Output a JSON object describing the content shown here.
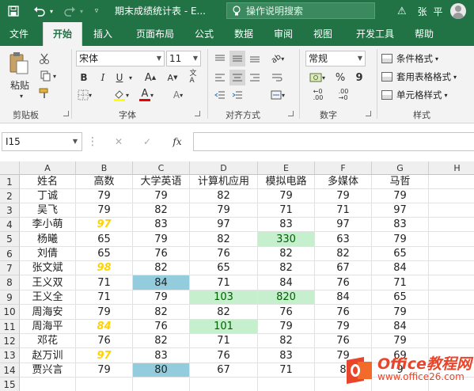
{
  "titlebar": {
    "title": "期末成绩统计表 - E...",
    "search_placeholder": "操作说明搜索",
    "user_name": "张 平",
    "icons": [
      "save-icon",
      "undo-icon",
      "redo-icon",
      "customize-icon",
      "lightbulb-icon",
      "warning-icon",
      "avatar"
    ]
  },
  "tabs": [
    "文件",
    "开始",
    "插入",
    "页面布局",
    "公式",
    "数据",
    "审阅",
    "视图",
    "开发工具",
    "帮助"
  ],
  "active_tab": "开始",
  "ribbon": {
    "clipboard": {
      "label": "剪贴板",
      "paste": "粘贴"
    },
    "font": {
      "label": "字体",
      "name": "宋体",
      "size": "11",
      "bold": "B",
      "italic": "I",
      "underline": "U",
      "font_color_letter": "A",
      "ab_glyph": "A"
    },
    "alignment": {
      "label": "对齐方式"
    },
    "number": {
      "label": "数字",
      "format": "常规",
      "percent": "%",
      "comma": "9"
    },
    "styles": {
      "label": "样式",
      "conditional": "条件格式",
      "table": "套用表格格式",
      "cell": "单元格样式"
    }
  },
  "formula_bar": {
    "name_box": "I15",
    "fx": "fx",
    "cancel": "✕",
    "enter": "✓",
    "value": ""
  },
  "sheet": {
    "columns": [
      "A",
      "B",
      "C",
      "D",
      "E",
      "F",
      "G",
      "H"
    ],
    "rows": [
      [
        "姓名",
        "高数",
        "大学英语",
        "计算机应用",
        "模拟电路",
        "多媒体",
        "马哲",
        ""
      ],
      [
        "丁诚",
        "79",
        "79",
        "82",
        "79",
        "79",
        "79",
        ""
      ],
      [
        "吴飞",
        "79",
        "82",
        "79",
        "71",
        "71",
        "97",
        ""
      ],
      [
        "李小萌",
        "97",
        "83",
        "97",
        "83",
        "97",
        "83",
        ""
      ],
      [
        "杨曦",
        "65",
        "79",
        "82",
        "330",
        "63",
        "79",
        ""
      ],
      [
        "刘倩",
        "65",
        "76",
        "76",
        "82",
        "82",
        "65",
        ""
      ],
      [
        "张文斌",
        "98",
        "82",
        "65",
        "82",
        "67",
        "84",
        ""
      ],
      [
        "王义双",
        "71",
        "84",
        "71",
        "84",
        "76",
        "71",
        ""
      ],
      [
        "王义全",
        "71",
        "79",
        "103",
        "820",
        "84",
        "65",
        ""
      ],
      [
        "周海安",
        "79",
        "82",
        "82",
        "76",
        "76",
        "79",
        ""
      ],
      [
        "周海平",
        "84",
        "76",
        "101",
        "79",
        "79",
        "84",
        ""
      ],
      [
        "邓花",
        "76",
        "82",
        "71",
        "82",
        "76",
        "79",
        ""
      ],
      [
        "赵万训",
        "97",
        "83",
        "76",
        "83",
        "79",
        "69",
        ""
      ],
      [
        "贾兴言",
        "79",
        "80",
        "67",
        "71",
        "8",
        "9",
        ""
      ],
      [
        "",
        "",
        "",
        "",
        "",
        "",
        "",
        ""
      ]
    ],
    "highlight_colors": {
      "yellow_text": "#ffd200",
      "blue_fill": "#93cddd",
      "green_fill": "#c6efce",
      "green_text": "#006100"
    }
  },
  "watermark": {
    "line1": "Office教程网",
    "line2": "www.office26.com"
  },
  "colors": {
    "brand": "#217346",
    "ribbon_bg": "#f3f3f3"
  }
}
